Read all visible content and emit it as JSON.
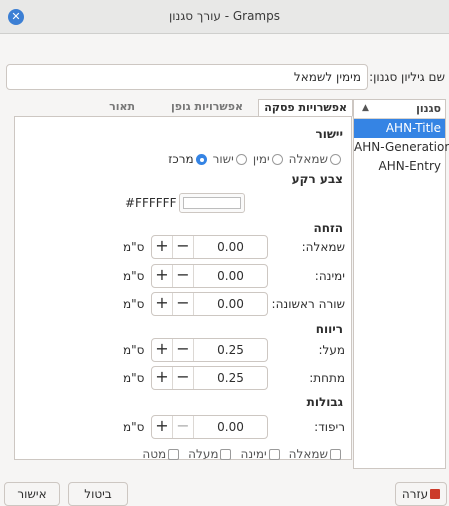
{
  "window": {
    "title": "עורך סגנון - Gramps"
  },
  "style_name": {
    "label": "שם גיליון סגנון:",
    "value": "מימין לשמאל"
  },
  "styles_list": {
    "header": "סגנון",
    "items": [
      "AHN-Title",
      "AHN-Generation",
      "AHN-Entry"
    ],
    "selected_index": 0
  },
  "tabs": [
    "תאור",
    "אפשרויות גופן",
    "אפשרויות פסקה"
  ],
  "active_tab": 2,
  "paragraph": {
    "alignment": {
      "heading": "יישור",
      "options": [
        "שמאלה",
        "ימין",
        "ישור",
        "מרכז"
      ],
      "selected": "מרכז"
    },
    "background": {
      "heading": "צבע רקע",
      "value": "#FFFFFF"
    },
    "indent": {
      "heading": "הזחה",
      "left": {
        "label": "שמאלה:",
        "value": "0.00",
        "unit": "ס\"מ"
      },
      "right": {
        "label": "ימינה:",
        "value": "0.00",
        "unit": "ס\"מ"
      },
      "first_line": {
        "label": "שורה ראשונה:",
        "value": "0.00",
        "unit": "ס\"מ"
      }
    },
    "spacing": {
      "heading": "ריווח",
      "above": {
        "label": "מעל:",
        "value": "0.25",
        "unit": "ס\"מ"
      },
      "below": {
        "label": "מתחת:",
        "value": "0.25",
        "unit": "ס\"מ"
      }
    },
    "borders": {
      "heading": "גבולות",
      "padding": {
        "label": "ריפוד:",
        "value": "0.00",
        "unit": "ס\"מ"
      },
      "checks": [
        "שמאלה",
        "ימינה",
        "מעלה",
        "מטה"
      ]
    }
  },
  "buttons": {
    "help": "עזרה",
    "cancel": "ביטול",
    "ok": "אישור"
  }
}
